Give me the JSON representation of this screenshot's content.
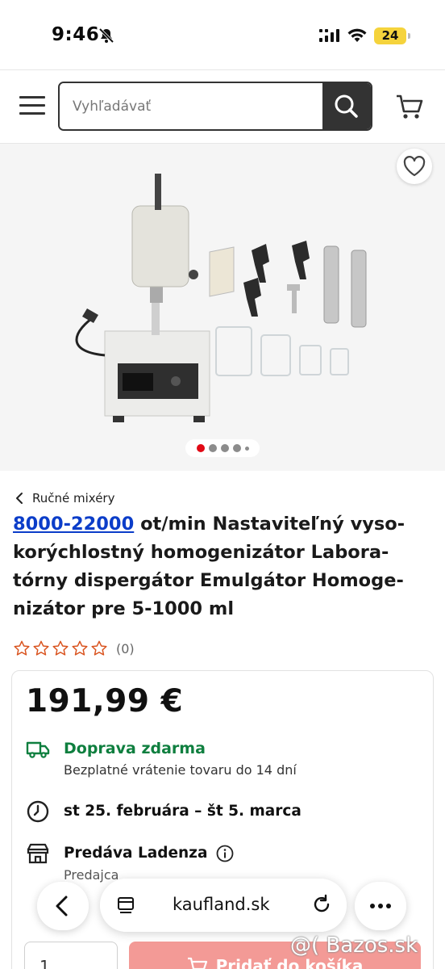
{
  "status_bar": {
    "time": "9:46",
    "battery": "24"
  },
  "header": {
    "search_placeholder": "Vyhľadávať"
  },
  "breadcrumb": {
    "label": "Ručné mixéry"
  },
  "product": {
    "title_link": "8000-22000",
    "title_rest": " ot/min Nastaviteľný vyso-korýchlostný homogenizátor Labora-tórny dispergátor Emulgátor Homoge-nizátor pre 5-1000 ml",
    "rating_count": "(0)",
    "price": "191,99 €",
    "shipping": "Doprava zdarma",
    "returns": "Bezplatné vrátenie tovaru do 14 dní",
    "delivery": "st 25. februára – št 5. marca",
    "seller": "Predáva Ladenza",
    "seller_sub": "Predajca",
    "quantity": "1",
    "add_to_cart": "Pridať do košíka"
  },
  "browser": {
    "url": "kaufland.sk"
  },
  "watermark": "@( Bazos.sk",
  "colors": {
    "accent": "#e10915",
    "shipping_green": "#0f7f3f",
    "link_blue": "#0b3dc9"
  },
  "gallery": {
    "total_dots": 5,
    "active_dot": 1
  }
}
